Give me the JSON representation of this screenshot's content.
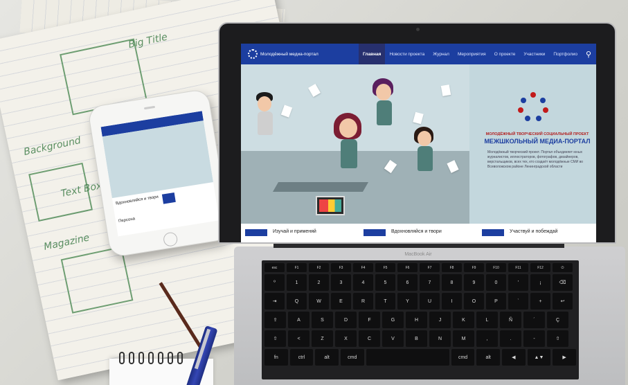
{
  "laptop": {
    "brand": "MacBook Air"
  },
  "site": {
    "logo_text": "Молодёжный медиа-портал",
    "nav": [
      {
        "label": "Главная",
        "active": true
      },
      {
        "label": "Новости проекта",
        "active": false
      },
      {
        "label": "Журнал",
        "active": false
      },
      {
        "label": "Мероприятия",
        "active": false
      },
      {
        "label": "О проекте",
        "active": false
      },
      {
        "label": "Участники",
        "active": false
      },
      {
        "label": "Портфолио",
        "active": false
      }
    ],
    "search_icon": "search-icon",
    "project": {
      "subtitle": "МОЛОДЁЖНЫЙ ТВОРЧЕСКИЙ СОЦИАЛЬНЫЙ ПРОЕКТ",
      "title": "МЕЖШКОЛЬНЫЙ МЕДИА-ПОРТАЛ",
      "description": "Молодёжный творческий проект. Портал объединяет юных журналистов, иллюстраторов, фотографов, дизайнеров, верстальщиков, всех тех, кто создаёт молодёжные СМИ во Всеволожском районе Ленинградской области"
    },
    "features": [
      {
        "label": "Изучай и применяй"
      },
      {
        "label": "Вдохновляйся и твори"
      },
      {
        "label": "Участвуй и побеждай"
      }
    ],
    "colors": {
      "primary": "#1c3ea0",
      "active": "#27306e",
      "accent": "#b22020"
    }
  },
  "phone": {
    "row1": "Вдохновляйся и твори",
    "row2": "Персона"
  },
  "notebook": {
    "notes": [
      "Big Title",
      "Text Boxes",
      "Magazine",
      "Background"
    ]
  },
  "keyboard": {
    "rows": [
      [
        "esc",
        "F1",
        "F2",
        "F3",
        "F4",
        "F5",
        "F6",
        "F7",
        "F8",
        "F9",
        "F10",
        "F11",
        "F12",
        "⏻"
      ],
      [
        "º",
        "1",
        "2",
        "3",
        "4",
        "5",
        "6",
        "7",
        "8",
        "9",
        "0",
        "'",
        "¡",
        "⌫"
      ],
      [
        "⇥",
        "Q",
        "W",
        "E",
        "R",
        "T",
        "Y",
        "U",
        "I",
        "O",
        "P",
        "`",
        "+",
        "↩"
      ],
      [
        "⇪",
        "A",
        "S",
        "D",
        "F",
        "G",
        "H",
        "J",
        "K",
        "L",
        "Ñ",
        "´",
        "Ç"
      ],
      [
        "⇧",
        "<",
        "Z",
        "X",
        "C",
        "V",
        "B",
        "N",
        "M",
        ",",
        ".",
        "-",
        "⇧"
      ],
      [
        "fn",
        "ctrl",
        "alt",
        "cmd",
        "",
        "cmd",
        "alt",
        "◀",
        "▲▼",
        "▶"
      ]
    ]
  }
}
